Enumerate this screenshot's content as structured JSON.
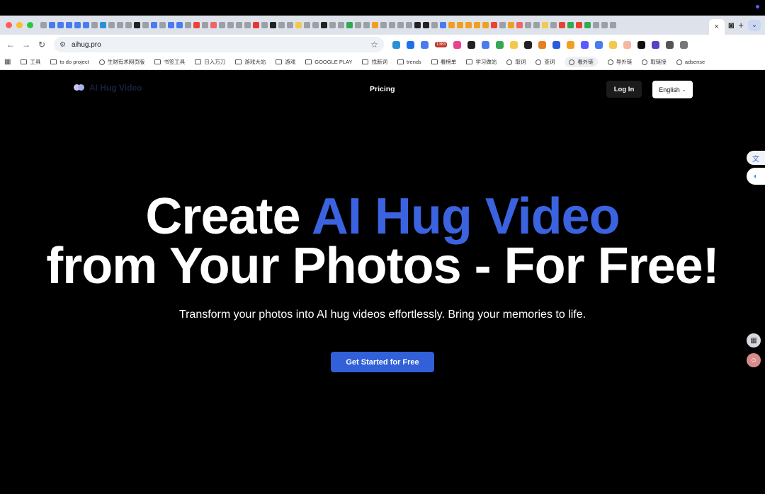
{
  "browser": {
    "url": "aihug.pro",
    "active_tab_close": "×",
    "new_tab": "+",
    "bookmarks": [
      {
        "label": "工具",
        "type": "folder"
      },
      {
        "label": "to do project",
        "type": "folder"
      },
      {
        "label": "生财有术网页版",
        "type": "site"
      },
      {
        "label": "书签工具",
        "type": "folder"
      },
      {
        "label": "日入万刀",
        "type": "folder"
      },
      {
        "label": "游戏大站",
        "type": "folder"
      },
      {
        "label": "游戏",
        "type": "folder"
      },
      {
        "label": "GOOGLE PLAY",
        "type": "folder"
      },
      {
        "label": "找新词",
        "type": "folder"
      },
      {
        "label": "trends",
        "type": "folder"
      },
      {
        "label": "看榜单",
        "type": "folder"
      },
      {
        "label": "学习做站",
        "type": "folder"
      },
      {
        "label": "取词",
        "type": "site"
      },
      {
        "label": "查词",
        "type": "site"
      },
      {
        "label": "看外链",
        "type": "site"
      },
      {
        "label": "导外链",
        "type": "site"
      },
      {
        "label": "取链接",
        "type": "site"
      },
      {
        "label": "adsense",
        "type": "site"
      }
    ],
    "extension_badge": "1383"
  },
  "site": {
    "logo_text": "AI Hug Video",
    "nav_pricing": "Pricing",
    "login_label": "Log In",
    "language_label": "English",
    "hero": {
      "title_part1": "Create ",
      "title_accent": "AI Hug Video",
      "title_line2": "from Your Photos - For Free!",
      "subtitle": "Transform your photos into AI hug videos effortlessly. Bring your memories to life.",
      "cta_label": "Get Started for Free"
    }
  },
  "colors": {
    "background": "#000000",
    "accent": "#3b63e0",
    "cta": "#3160d8"
  }
}
